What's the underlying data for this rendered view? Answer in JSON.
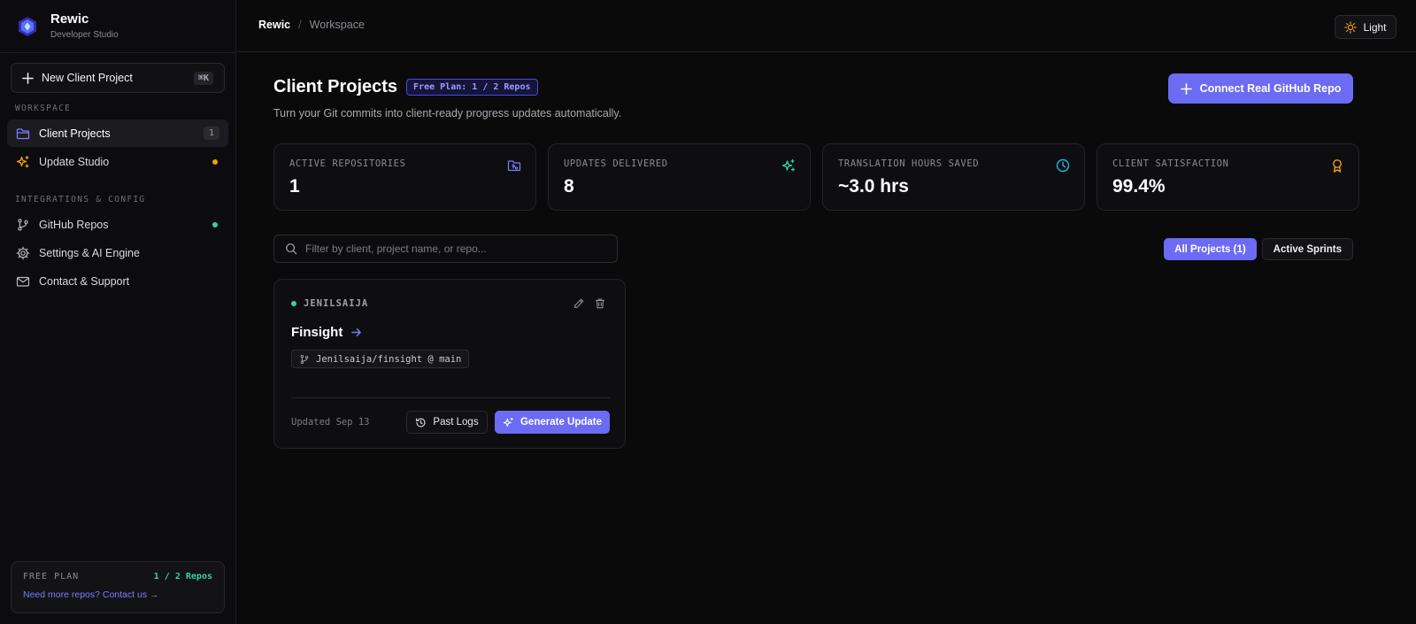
{
  "brand": {
    "name": "Rewic",
    "subtitle": "Developer Studio"
  },
  "sidebar": {
    "new_button": {
      "label": "New Client Project",
      "shortcut": "⌘K"
    },
    "sections": [
      {
        "label": "WORKSPACE"
      },
      {
        "label": "INTEGRATIONS & CONFIG"
      }
    ],
    "items": [
      {
        "label": "Client Projects",
        "icon": "folder-icon",
        "badge": "1",
        "active": true
      },
      {
        "label": "Update Studio",
        "icon": "sparkles-icon",
        "status_color": "#f59e0b"
      },
      {
        "label": "GitHub Repos",
        "icon": "git-branch-icon",
        "status_color": "#34d399"
      },
      {
        "label": "Settings & AI Engine",
        "icon": "gear-icon"
      },
      {
        "label": "Contact & Support",
        "icon": "mail-icon"
      }
    ],
    "plan": {
      "title": "FREE PLAN",
      "count": "1 / 2 Repos",
      "link": "Need more repos? Contact us →"
    }
  },
  "topbar": {
    "breadcrumb": {
      "root": "Rewic",
      "separator": "/",
      "current": "Workspace"
    },
    "theme_toggle": {
      "label": "Light",
      "icon": "sun-icon"
    }
  },
  "main": {
    "title": "Client Projects",
    "plan_pill": "Free Plan: 1 / 2 Repos",
    "subtitle": "Turn your Git commits into client-ready progress updates automatically.",
    "connect_button": "Connect Real GitHub Repo",
    "stats": [
      {
        "label": "ACTIVE REPOSITORIES",
        "value": "1",
        "icon": "folder-git-icon",
        "color": "#7c7cff"
      },
      {
        "label": "UPDATES DELIVERED",
        "value": "8",
        "icon": "sparkles-icon",
        "color": "#34d399"
      },
      {
        "label": "TRANSLATION HOURS SAVED",
        "value": "~3.0 hrs",
        "icon": "clock-icon",
        "color": "#22b8e0"
      },
      {
        "label": "CLIENT SATISFACTION",
        "value": "99.4%",
        "icon": "award-icon",
        "color": "#f59e0b"
      }
    ],
    "search": {
      "placeholder": "Filter by client, project name, or repo...",
      "value": ""
    },
    "filters": {
      "all": "All Projects (1)",
      "active": "Active Sprints"
    },
    "projects": [
      {
        "client": "JENILSAIJA",
        "name": "Finsight",
        "repo": "Jenilsaija/finsight @ main",
        "updated": "Updated Sep 13",
        "past_logs": "Past Logs",
        "generate": "Generate Update"
      }
    ]
  },
  "colors": {
    "accent": "#6b6bf3",
    "success": "#34d399",
    "warning": "#f59e0b",
    "background": "#0a0a0b"
  }
}
